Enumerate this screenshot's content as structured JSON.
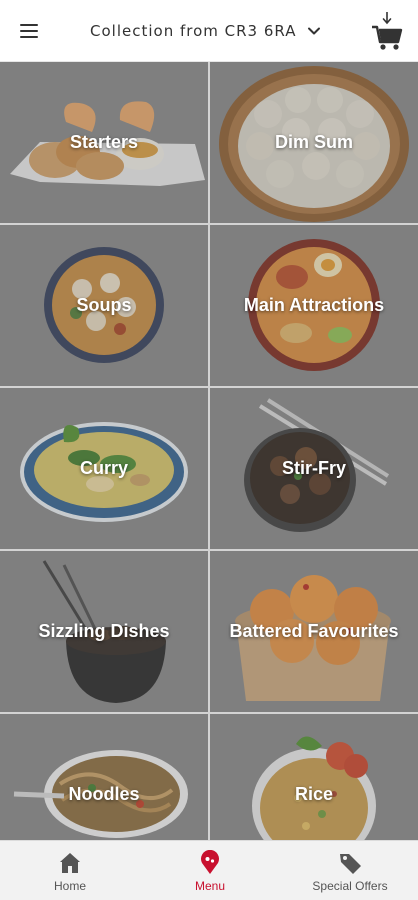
{
  "header": {
    "collection_text": "Collection from CR3 6RA"
  },
  "menu_categories": [
    {
      "label": "Starters"
    },
    {
      "label": "Dim Sum"
    },
    {
      "label": "Soups"
    },
    {
      "label": "Main Attractions"
    },
    {
      "label": "Curry"
    },
    {
      "label": "Stir-Fry"
    },
    {
      "label": "Sizzling Dishes"
    },
    {
      "label": "Battered Favourites"
    },
    {
      "label": "Noodles"
    },
    {
      "label": "Rice"
    }
  ],
  "bottom_nav": {
    "items": [
      {
        "label": "Home",
        "icon": "home-icon",
        "active": false
      },
      {
        "label": "Menu",
        "icon": "map-pin-icon",
        "active": true
      },
      {
        "label": "Special Offers",
        "icon": "price-tag-icon",
        "active": false
      }
    ]
  },
  "colors": {
    "accent": "#c8102e",
    "tile_overlay": "#858585",
    "nav_background": "#f2f2f2"
  }
}
